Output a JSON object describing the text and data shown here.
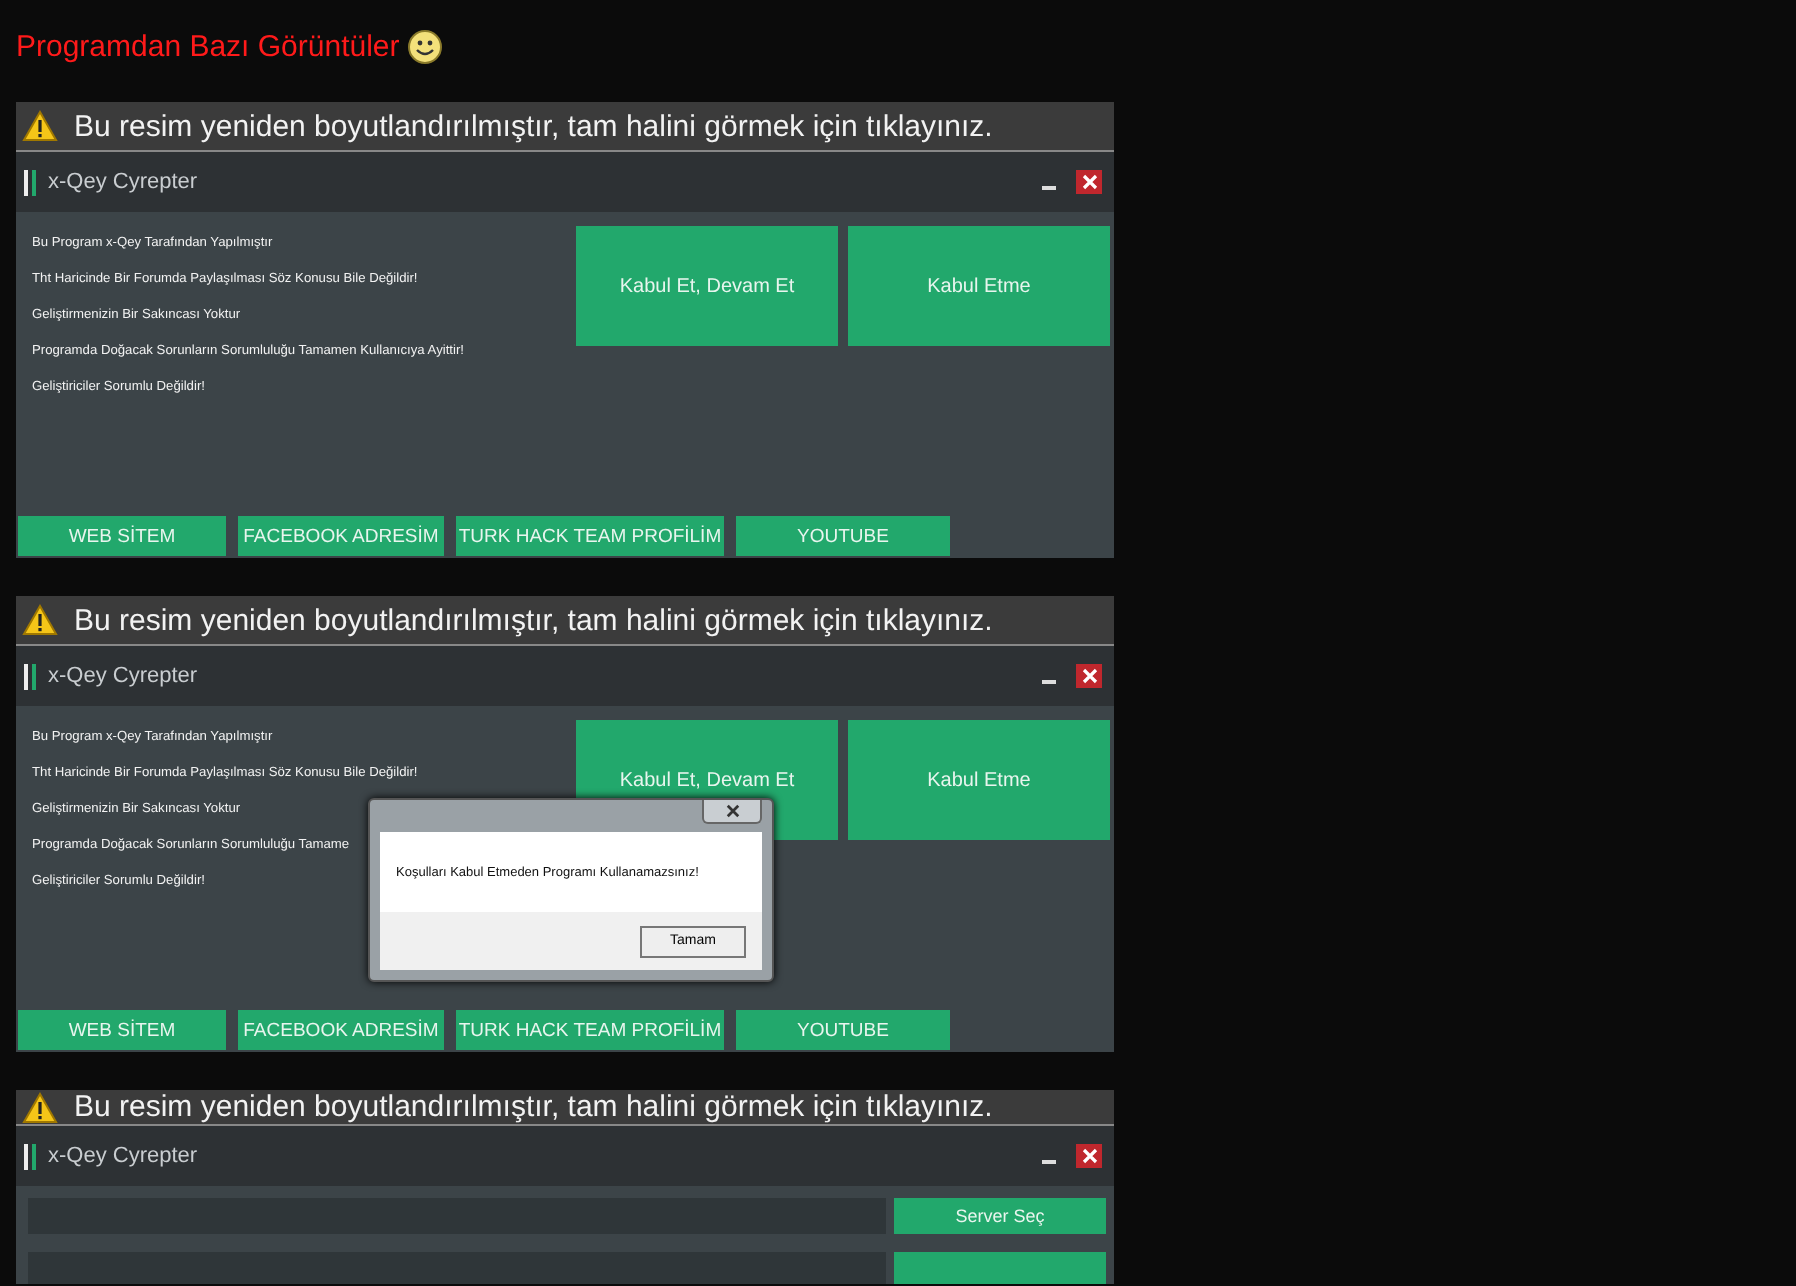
{
  "heading": {
    "text": "Programdan Bazı Görüntüler"
  },
  "screenshots": [
    {
      "banner": "Bu resim yeniden boyutlandırılmıştır, tam halini görmek için tıklayınız.",
      "window": {
        "kind": "terms",
        "title": "x-Qey Cyrepter",
        "lines": [
          "Bu Program x-Qey Tarafından Yapılmıştır",
          "Tht Haricinde Bir Forumda Paylaşılması Söz Konusu Bile Değildir!",
          "Geliştirmenizin Bir Sakıncası Yoktur",
          "Programda Doğacak Sorunların Sorumluluğu Tamamen Kullanıcıya Ayittir!",
          "Geliştiriciler Sorumlu Değildir!"
        ],
        "actions": [
          "Kabul Et, Devam Et",
          "Kabul Etme"
        ],
        "links": [
          "WEB SİTEM",
          "FACEBOOK ADRESİM",
          "TURK HACK TEAM PROFİLİM",
          "YOUTUBE"
        ]
      }
    },
    {
      "banner": "Bu resim yeniden boyutlandırılmıştır, tam halini görmek için tıklayınız.",
      "window": {
        "kind": "terms",
        "title": "x-Qey Cyrepter",
        "lines": [
          "Bu Program x-Qey Tarafından Yapılmıştır",
          "Tht Haricinde Bir Forumda Paylaşılması Söz Konusu Bile Değildir!",
          "Geliştirmenizin Bir Sakıncası Yoktur",
          "Programda Doğacak Sorunların Sorumluluğu Tamame",
          "Geliştiriciler Sorumlu Değildir!"
        ],
        "actions": [
          "Kabul Et, Devam Et",
          "Kabul Etme"
        ],
        "links": [
          "WEB SİTEM",
          "FACEBOOK ADRESİM",
          "TURK HACK TEAM PROFİLİM",
          "YOUTUBE"
        ]
      },
      "dialog": {
        "message": "Koşulları Kabul Etmeden Programı Kullanamazsınız!",
        "button": "Tamam"
      }
    },
    {
      "banner": "Bu resim yeniden boyutlandırılmıştır, tam halini görmek için tıklayınız.",
      "window": {
        "kind": "builder",
        "title": "x-Qey Cyrepter",
        "rows": [
          {
            "button": "Server Seç"
          },
          {}
        ]
      }
    }
  ]
}
